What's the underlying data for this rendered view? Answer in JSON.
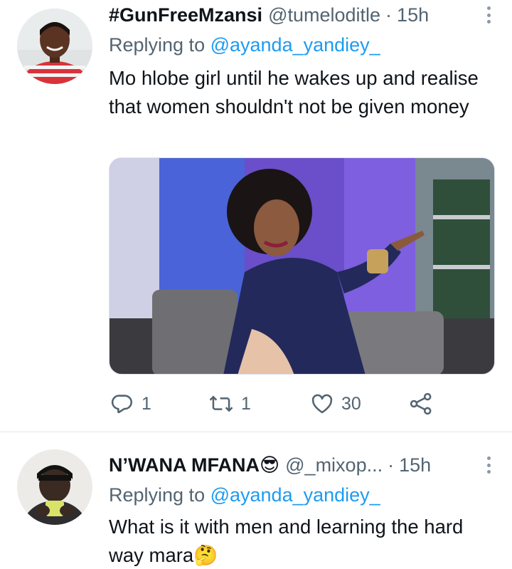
{
  "tweets": [
    {
      "display_name": "#GunFreeMzansi",
      "handle": "@tumeloditle",
      "dot": "·",
      "time": "15h",
      "replying_label": "Replying to ",
      "replying_mention": "@ayanda_yandiey_",
      "text": "Mo hlobe girl until he wakes up and realise that women shouldn't not be given money",
      "has_media": true,
      "actions": {
        "replies": "1",
        "retweets": "1",
        "likes": "30"
      }
    },
    {
      "display_name": "N’WANA MFANA😎",
      "handle": "@_mixop...",
      "dot": "·",
      "time": "15h",
      "replying_label": "Replying to ",
      "replying_mention": "@ayanda_yandiey_",
      "text": "What is it with men and learning the hard way mara🤔"
    }
  ],
  "icons": {
    "reply": "reply-bubble-icon",
    "retweet": "retweet-arrows-icon",
    "like": "heart-icon",
    "share": "share-nodes-icon",
    "more": "more-dots-icon"
  },
  "colors": {
    "text": "#0f1419",
    "secondary": "#536471",
    "link": "#1d9bf0",
    "divider": "#e1e6ea"
  }
}
